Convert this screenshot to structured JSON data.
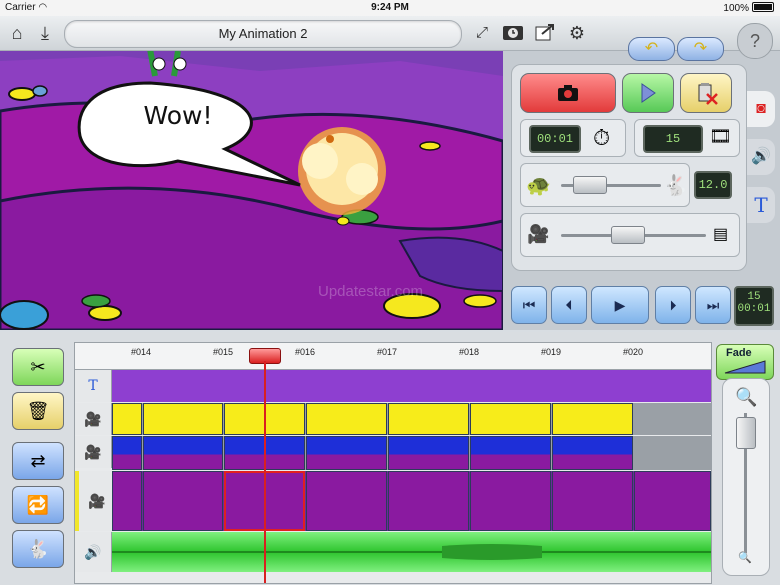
{
  "status": {
    "carrier": "Carrier",
    "time": "9:24 PM",
    "battery": "100%"
  },
  "toolbar": {
    "title": "My Animation 2"
  },
  "canvas": {
    "speech_text": "Wow!",
    "watermark": "Updatestar.com"
  },
  "panel": {
    "time_display": "00:01",
    "frame_count": "15",
    "fps": "12.0",
    "frame_number": "15",
    "frame_time": "00:01",
    "help_label": "?"
  },
  "timeline": {
    "ruler_labels": [
      "#014",
      "#015",
      "#016",
      "#017",
      "#018",
      "#019",
      "#020"
    ],
    "text_track_label": "T",
    "fade_label": "Fade"
  },
  "colors": {
    "canvas_purple": "#7a3fb5",
    "record_red": "#e23b3b",
    "play_green": "#57c957",
    "lcd_green": "#9fe07c",
    "playhead_red": "#d92020"
  }
}
